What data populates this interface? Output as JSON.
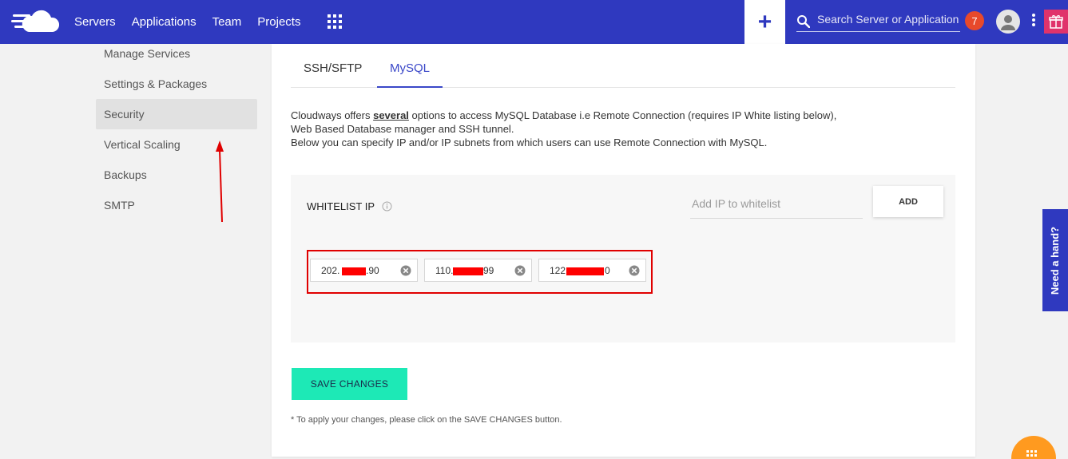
{
  "topbar": {
    "nav": [
      "Servers",
      "Applications",
      "Team",
      "Projects"
    ],
    "search_placeholder": "Search Server or Application",
    "notification_count": "7",
    "plus_label": "+"
  },
  "sidebar": {
    "items": [
      {
        "label": "Manage Services",
        "active": false
      },
      {
        "label": "Settings & Packages",
        "active": false
      },
      {
        "label": "Security",
        "active": true
      },
      {
        "label": "Vertical Scaling",
        "active": false
      },
      {
        "label": "Backups",
        "active": false
      },
      {
        "label": "SMTP",
        "active": false
      }
    ]
  },
  "tabs": [
    "SSH/SFTP",
    "MySQL"
  ],
  "description": {
    "line1_pre": "Cloudways offers ",
    "line1_link": "several",
    "line1_post": " options to access MySQL Database i.e Remote Connection (requires IP White listing below), Web Based Database manager and SSH tunnel.",
    "line2": "Below you can specify IP and/or IP subnets from which users can use Remote Connection with MySQL."
  },
  "whitelist": {
    "label": "WHITELIST IP",
    "add_placeholder": "Add IP to whitelist",
    "add_button": "ADD",
    "ips": [
      {
        "prefix": "202.",
        "suffix": ".90"
      },
      {
        "prefix": "110.",
        "suffix": "99"
      },
      {
        "prefix": "122",
        "suffix": "0"
      }
    ]
  },
  "save_button": "SAVE CHANGES",
  "note": "* To apply your changes, please click on the SAVE CHANGES button.",
  "help_tab": "Need a hand?",
  "colors": {
    "topbar": "#2f39bf",
    "accent": "#3a47c8",
    "save": "#1de9b6",
    "badge": "#e8492b",
    "highlight": "#e00000"
  }
}
